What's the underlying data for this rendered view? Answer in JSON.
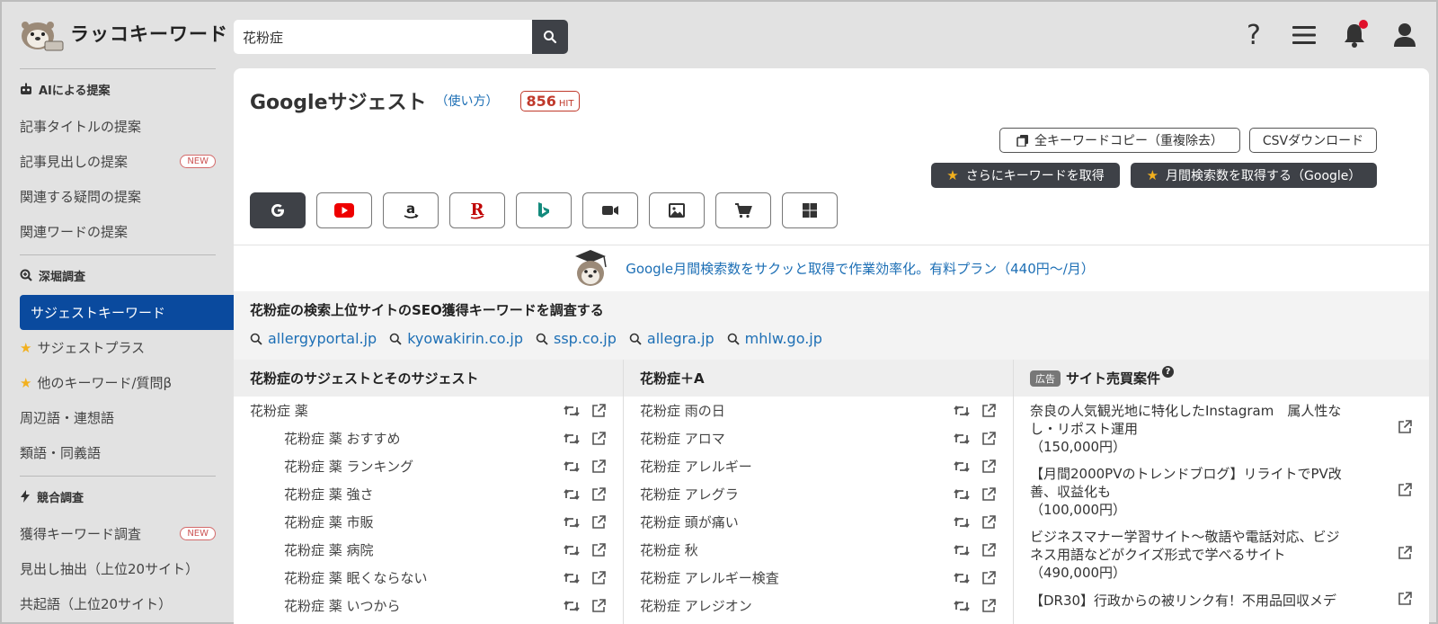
{
  "app": {
    "logo_text": "ラッコキーワード"
  },
  "search": {
    "value": "花粉症",
    "placeholder": ""
  },
  "header": {
    "icons": [
      "help-icon",
      "menu-icon",
      "bell-icon",
      "user-icon"
    ]
  },
  "sidebar": {
    "section_ai": "AIによる提案",
    "ai_items": [
      {
        "label": "記事タイトルの提案",
        "badge": ""
      },
      {
        "label": "記事見出しの提案",
        "badge": "NEW"
      },
      {
        "label": "関連する疑問の提案",
        "badge": ""
      },
      {
        "label": "関連ワードの提案",
        "badge": ""
      }
    ],
    "section_deep": "深堀調査",
    "deep_items": [
      {
        "label": "サジェストキーワード",
        "star": false,
        "active": true
      },
      {
        "label": "サジェストプラス",
        "star": true
      },
      {
        "label": "他のキーワード/質問β",
        "star": true
      },
      {
        "label": "周辺語・連想語",
        "star": false
      },
      {
        "label": "類語・同義語",
        "star": false
      }
    ],
    "section_comp": "競合調査",
    "comp_items": [
      {
        "label": "獲得キーワード調査",
        "badge": "NEW"
      },
      {
        "label": "見出し抽出（上位20サイト）",
        "badge": ""
      },
      {
        "label": "共起語（上位20サイト）",
        "badge": ""
      }
    ]
  },
  "main": {
    "title": "Googleサジェスト",
    "howto": "（使い方）",
    "hit_count": "856",
    "hit_unit": "HIT",
    "copy_all": "全キーワードコピー（重複除去）",
    "csv": "CSVダウンロード",
    "more_keywords": "さらにキーワードを取得",
    "monthly_volume": "月間検索数を取得する（Google）",
    "engines": [
      "google",
      "youtube",
      "amazon",
      "rakuten",
      "bing",
      "video",
      "image",
      "shopping",
      "windows"
    ],
    "promo": "Google月間検索数をサクッと取得で作業効率化。有料プラン（440円〜/月）",
    "seo_title": "花粉症の検索上位サイトのSEO獲得キーワードを調査する",
    "seo_links": [
      "allergyportal.jp",
      "kyowakirin.co.jp",
      "ssp.co.jp",
      "allegra.jp",
      "mhlw.go.jp"
    ]
  },
  "col1": {
    "header": "花粉症のサジェストとそのサジェスト",
    "rows": [
      {
        "text": "花粉症 薬",
        "sub": false
      },
      {
        "text": "花粉症 薬 おすすめ",
        "sub": true
      },
      {
        "text": "花粉症 薬 ランキング",
        "sub": true
      },
      {
        "text": "花粉症 薬 強さ",
        "sub": true
      },
      {
        "text": "花粉症 薬 市販",
        "sub": true
      },
      {
        "text": "花粉症 薬 病院",
        "sub": true
      },
      {
        "text": "花粉症 薬 眠くならない",
        "sub": true
      },
      {
        "text": "花粉症 薬 いつから",
        "sub": true
      }
    ]
  },
  "col2": {
    "header": "花粉症＋A",
    "rows": [
      "花粉症 雨の日",
      "花粉症 アロマ",
      "花粉症 アレルギー",
      "花粉症 アレグラ",
      "花粉症 頭が痛い",
      "花粉症 秋",
      "花粉症 アレルギー検査",
      "花粉症 アレジオン"
    ]
  },
  "col3": {
    "ad_label": "広告",
    "header": "サイト売買案件",
    "help": "?",
    "items": [
      {
        "line1": "奈良の人気観光地に特化したInstagram　属人性な",
        "line2": "し・リポスト運用",
        "price": "（150,000円）"
      },
      {
        "line1": "【月間2000PVのトレンドブログ】リライトでPV改",
        "line2": "善、収益化も",
        "price": "（100,000円）"
      },
      {
        "line1": "ビジネスマナー学習サイト〜敬語や電話対応、ビジ",
        "line2": "ネス用語などがクイズ形式で学べるサイト",
        "price": "（490,000円）"
      },
      {
        "line1": "【DR30】行政からの被リンク有！不用品回収メデ",
        "line2": "",
        "price": ""
      }
    ]
  },
  "colors": {
    "accent": "#0a4a9e",
    "link": "#1d6fb5",
    "dark_button": "#3e4147",
    "hit_red": "#c0392b",
    "star": "#f2b01e"
  }
}
